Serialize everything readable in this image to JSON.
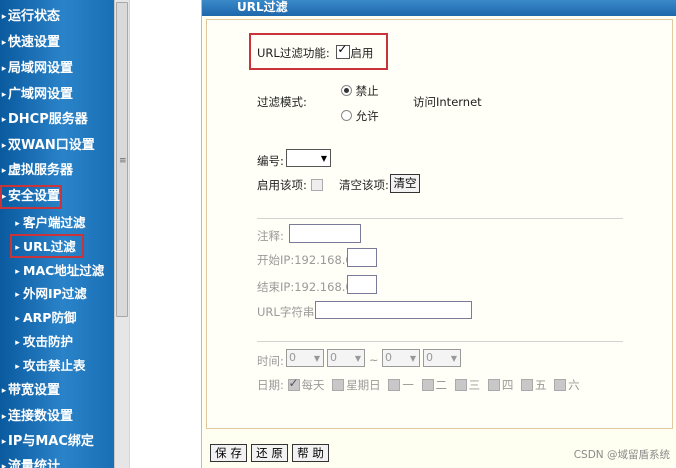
{
  "sidebar": {
    "items": [
      {
        "label": "运行状态"
      },
      {
        "label": "快速设置"
      },
      {
        "label": "局域网设置"
      },
      {
        "label": "广域网设置"
      },
      {
        "label": "DHCP服务器"
      },
      {
        "label": "双WAN口设置"
      },
      {
        "label": "虚拟服务器"
      },
      {
        "label": "安全设置"
      }
    ],
    "sub_items": [
      {
        "label": "客户端过滤"
      },
      {
        "label": "URL过滤"
      },
      {
        "label": "MAC地址过滤"
      },
      {
        "label": "外网IP过滤"
      },
      {
        "label": "ARP防御"
      },
      {
        "label": "攻击防护"
      },
      {
        "label": "攻击禁止表"
      }
    ],
    "items_after": [
      {
        "label": "带宽设置"
      },
      {
        "label": "连接数设置"
      },
      {
        "label": "IP与MAC绑定"
      },
      {
        "label": "流量统计"
      }
    ],
    "scroll_grip": "≡"
  },
  "content": {
    "title": "URL过滤",
    "filter_function": {
      "label": "URL过滤功能:",
      "enable_label": "启用",
      "enabled": true
    },
    "filter_mode": {
      "label": "过滤模式:",
      "options": [
        "禁止",
        "允许"
      ],
      "selected": "禁止",
      "target": "访问Internet"
    },
    "number": {
      "label": "编号:",
      "value": ""
    },
    "enable_item": {
      "label": "启用该项:",
      "checked": false
    },
    "clear_item": {
      "label": "清空该项:",
      "button": "清空"
    },
    "note": {
      "label": "注释:",
      "value": ""
    },
    "start_ip": {
      "label": "开始IP:192.168.0.",
      "value": ""
    },
    "end_ip": {
      "label": "结束IP:192.168.0.",
      "value": ""
    },
    "url_string": {
      "label": "URL字符串:",
      "value": ""
    },
    "time": {
      "label": "时间:",
      "values": [
        "0",
        "0",
        "0",
        "0"
      ],
      "separator": "~"
    },
    "date": {
      "label": "日期:",
      "days": [
        {
          "label": "每天",
          "checked": true
        },
        {
          "label": "星期日",
          "checked": false
        },
        {
          "label": "一",
          "checked": false
        },
        {
          "label": "二",
          "checked": false
        },
        {
          "label": "三",
          "checked": false
        },
        {
          "label": "四",
          "checked": false
        },
        {
          "label": "五",
          "checked": false
        },
        {
          "label": "六",
          "checked": false
        }
      ]
    },
    "buttons": {
      "save": "保 存",
      "restore": "还 原",
      "help": "帮 助"
    }
  },
  "watermark": "CSDN @域留盾系统",
  "colors": {
    "sidebar": "#1a6fb4",
    "header": "#1d67ab",
    "highlight": "#c9343a",
    "panel_bg": "#fffff7"
  }
}
